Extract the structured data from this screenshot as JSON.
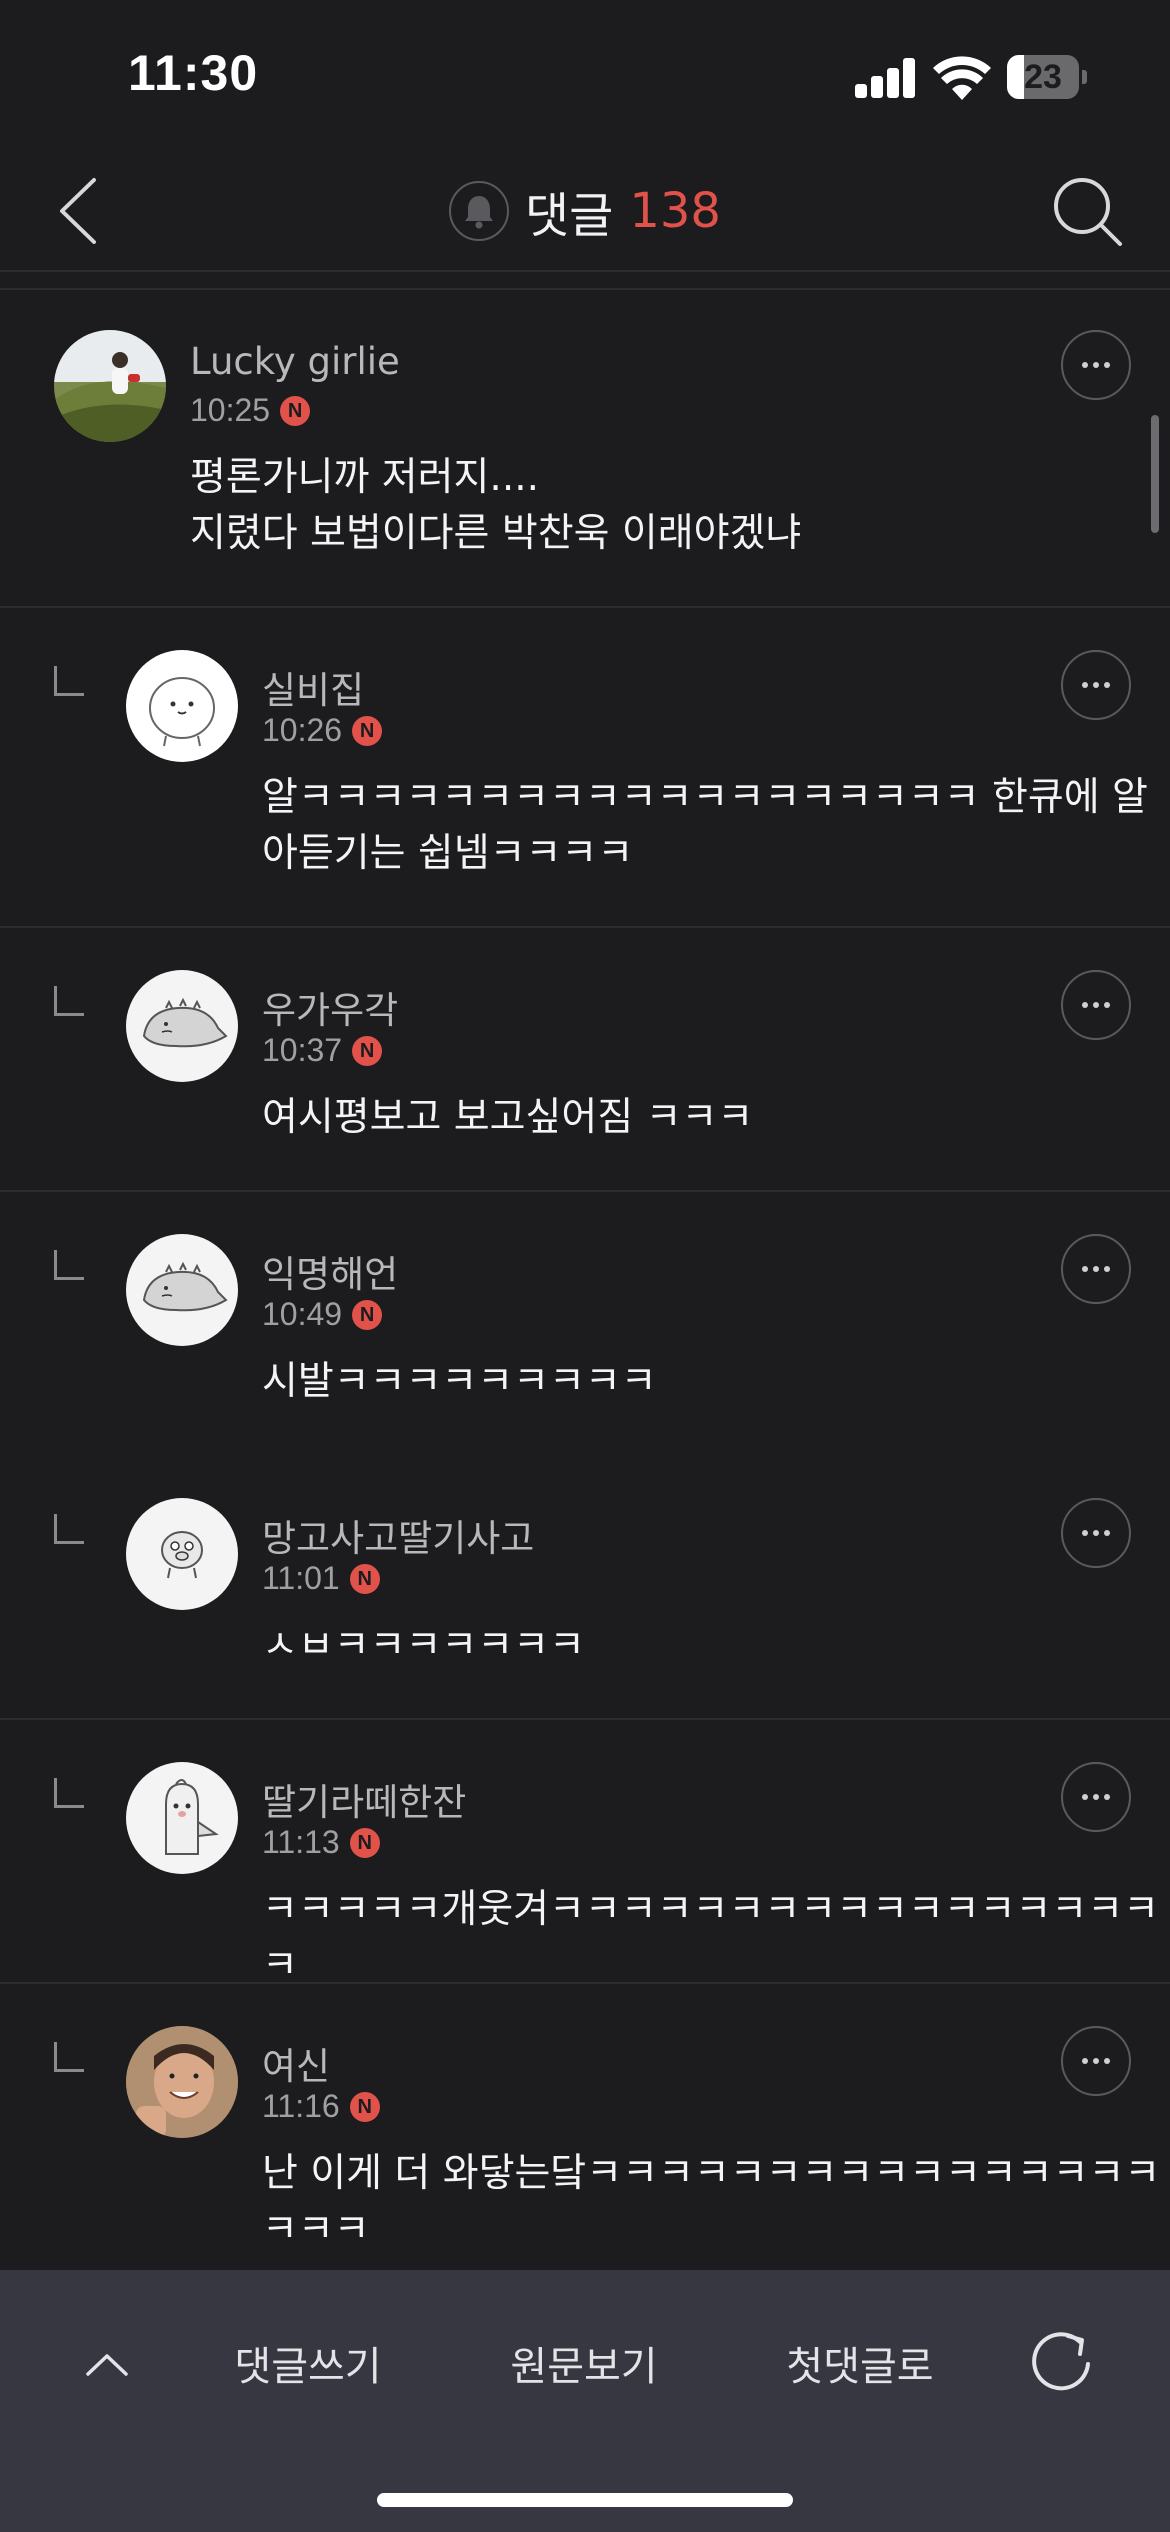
{
  "status": {
    "time": "11:30",
    "battery": "23",
    "battery_level": 0.23
  },
  "header": {
    "title": "댓글",
    "count": "138"
  },
  "comments": [
    {
      "nickname": "Lucky girlie",
      "time": "10:25",
      "badge": "N",
      "lines": [
        "평론가니까 저러지....",
        "지렸다 보법이다른 박찬욱 이래야겠냐"
      ],
      "reply": false,
      "avatar": "photo-person-field"
    },
    {
      "nickname": "실비집",
      "time": "10:26",
      "badge": "N",
      "lines": [
        "알ㅋㅋㅋㅋㅋㅋㅋㅋㅋㅋㅋㅋㅋㅋㅋㅋㅋㅋㅋ 한큐에 알",
        "아듣기는 쉽넴ㅋㅋㅋㅋ"
      ],
      "reply": true,
      "avatar": "round-character"
    },
    {
      "nickname": "우가우각",
      "time": "10:37",
      "badge": "N",
      "lines": [
        "여시평보고 보고싶어짐 ㅋㅋㅋ"
      ],
      "reply": true,
      "avatar": "dino-character"
    },
    {
      "nickname": "익명해언",
      "time": "10:49",
      "badge": "N",
      "lines": [
        "시발ㅋㅋㅋㅋㅋㅋㅋㅋㅋ"
      ],
      "reply": true,
      "avatar": "dino-character"
    },
    {
      "nickname": "망고사고딸기사고",
      "time": "11:01",
      "badge": "N",
      "lines": [
        "ㅅㅂㅋㅋㅋㅋㅋㅋㅋ"
      ],
      "reply": true,
      "avatar": "pig-character"
    },
    {
      "nickname": "딸기라떼한잔",
      "time": "11:13",
      "badge": "N",
      "lines": [
        "ㅋㅋㅋㅋㅋ개웃겨ㅋㅋㅋㅋㅋㅋㅋㅋㅋㅋㅋㅋㅋㅋㅋㅋㅋㅋ"
      ],
      "reply": true,
      "avatar": "bird-character"
    },
    {
      "nickname": "여신",
      "time": "11:16",
      "badge": "N",
      "lines": [
        "난 이게 더 와닿는닼ㅋㅋㅋㅋㅋㅋㅋㅋㅋㅋㅋㅋㅋㅋㅋㅋ",
        "ㅋㅋㅋ"
      ],
      "reply": true,
      "avatar": "photo-man-smiling"
    }
  ],
  "bottom": {
    "write": "댓글쓰기",
    "original": "원문보기",
    "first": "첫댓글로"
  },
  "colors": {
    "background": "#1c1c1e",
    "accent": "#e0524a",
    "bottom_bar": "#363740"
  }
}
